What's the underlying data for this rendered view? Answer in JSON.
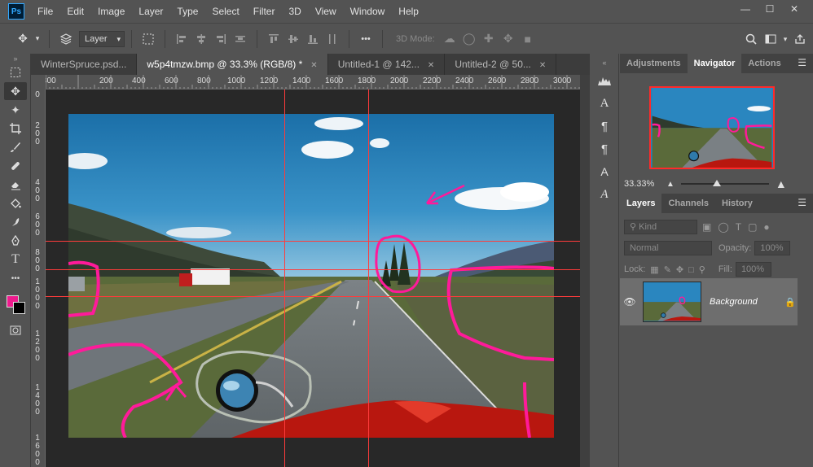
{
  "app": {
    "logo": "Ps"
  },
  "menu": [
    "File",
    "Edit",
    "Image",
    "Layer",
    "Type",
    "Select",
    "Filter",
    "3D",
    "View",
    "Window",
    "Help"
  ],
  "window_controls": [
    "—",
    "☐",
    "✕"
  ],
  "options": {
    "layer_select": "Layer",
    "mode_3d": "3D Mode:",
    "more": "•••"
  },
  "tabs": [
    {
      "label": "WinterSpruce.psd...",
      "close": ""
    },
    {
      "label": "w5p4tmzw.bmp @ 33.3% (RGB/8) *",
      "close": "✕"
    },
    {
      "label": "Untitled-1 @ 142...",
      "close": "✕"
    },
    {
      "label": "Untitled-2 @ 50...",
      "close": "✕"
    }
  ],
  "ruler_h": [
    "300",
    "200",
    "400",
    "600",
    "800",
    "1000",
    "1200",
    "1400",
    "1600",
    "1800",
    "2000",
    "2200",
    "2400",
    "2600",
    "2800",
    "3000"
  ],
  "ruler_v": [
    "0",
    "2",
    "0",
    "0",
    "4",
    "0",
    "0",
    "6",
    "0",
    "0",
    "8",
    "0",
    "0",
    "1",
    "0",
    "0",
    "0",
    "1",
    "2",
    "0",
    "0",
    "1",
    "4",
    "0",
    "0",
    "1",
    "6",
    "0",
    "0"
  ],
  "status": {
    "zoom": "33.33%"
  },
  "nav_panel": {
    "tabs": [
      "Adjustments",
      "Navigator",
      "Actions"
    ],
    "active": 1,
    "zoom": "33.33%",
    "zoom_fraction": 0.41
  },
  "layers_panel": {
    "tabs": [
      "Layers",
      "Channels",
      "History"
    ],
    "kind_placeholder": "Kind",
    "blend_mode": "Normal",
    "opacity_label": "Opacity:",
    "opacity_value": "100%",
    "lock_label": "Lock:",
    "fill_label": "Fill:",
    "fill_value": "100%",
    "layers": [
      {
        "name": "Background",
        "visible": true,
        "locked": true
      }
    ]
  },
  "colors": {
    "foreground": "#ee1b8e",
    "background": "#000000",
    "guide": "#ff3b3b",
    "annotation": "#ff1a9a",
    "sky": "#2a7fb5"
  }
}
